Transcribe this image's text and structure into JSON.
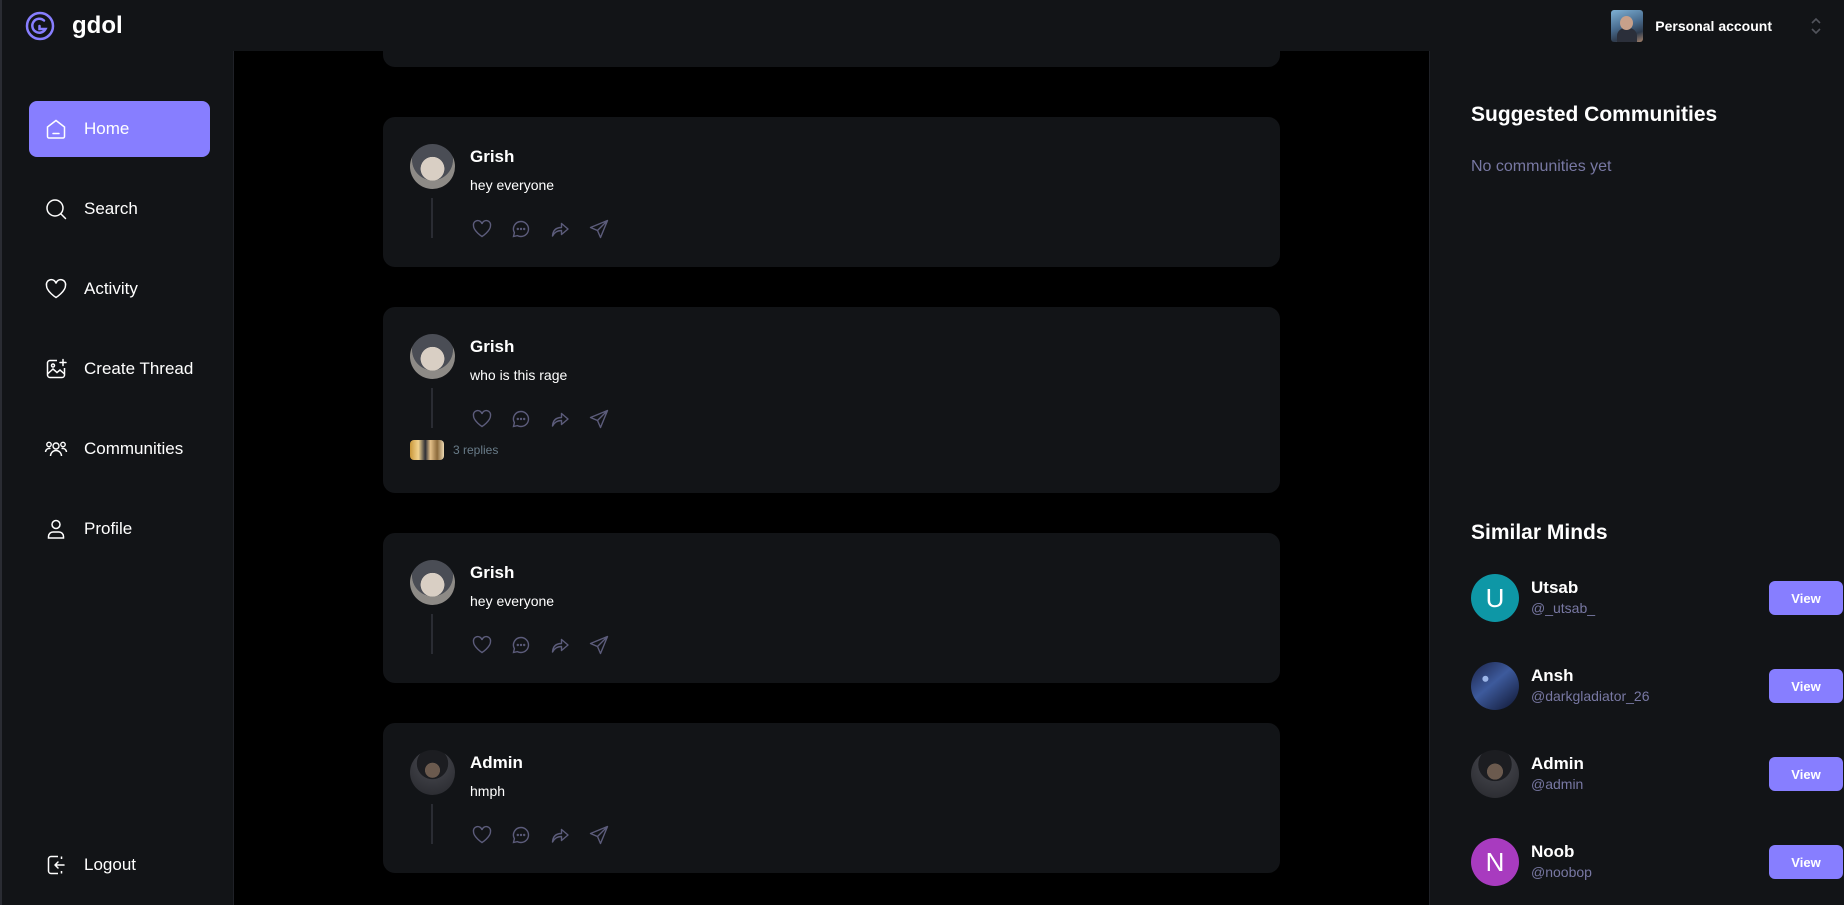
{
  "app": {
    "name": "gdol",
    "accent": "#877eff"
  },
  "account": {
    "label": "Personal account"
  },
  "sidebar": {
    "items": [
      {
        "label": "Home",
        "icon": "home-icon",
        "active": true
      },
      {
        "label": "Search",
        "icon": "search-icon"
      },
      {
        "label": "Activity",
        "icon": "heart-icon"
      },
      {
        "label": "Create Thread",
        "icon": "create-thread-icon"
      },
      {
        "label": "Communities",
        "icon": "communities-icon"
      },
      {
        "label": "Profile",
        "icon": "user-icon"
      }
    ],
    "logout": "Logout"
  },
  "feed": {
    "threads": [
      {
        "author": "Grish",
        "content": "hey everyone",
        "replies": ""
      },
      {
        "author": "Grish",
        "content": "who is this rage",
        "replies": "3 replies"
      },
      {
        "author": "Grish",
        "content": "hey everyone",
        "replies": ""
      },
      {
        "author": "Admin",
        "content": "hmph",
        "replies": ""
      }
    ]
  },
  "rightbar": {
    "suggested_title": "Suggested Communities",
    "suggested_empty": "No communities yet",
    "similar_title": "Similar Minds",
    "view_label": "View",
    "minds": [
      {
        "name": "Utsab",
        "handle": "@_utsab_",
        "initial": "U",
        "color": "#0e97a6"
      },
      {
        "name": "Ansh",
        "handle": "@darkgladiator_26",
        "initial": "",
        "color": "#2b3a6a"
      },
      {
        "name": "Admin",
        "handle": "@admin",
        "initial": "",
        "color": "#2a2b30"
      },
      {
        "name": "Noob",
        "handle": "@noobop",
        "initial": "N",
        "color": "#a83bbf"
      }
    ]
  }
}
